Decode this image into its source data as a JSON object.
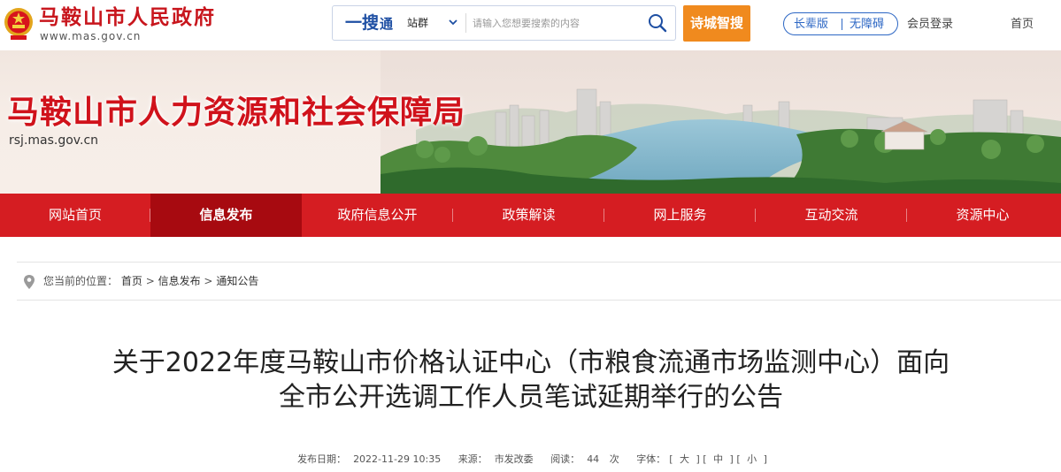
{
  "header": {
    "site_name": "马鞍山市人民政府",
    "site_url": "www.mas.gov.cn",
    "search": {
      "brand_a": "一搜",
      "brand_b": "通",
      "scope": "站群",
      "placeholder": "请输入您想要搜索的内容"
    },
    "poetry_search": "诗城智搜",
    "elder_mode": "长辈版",
    "accessibility": "无障碍",
    "member_login": "会员登录",
    "home": "首页"
  },
  "banner": {
    "bureau_name": "马鞍山市人力资源和社会保障局",
    "bureau_url": "rsj.mas.gov.cn"
  },
  "nav": {
    "items": [
      {
        "label": "网站首页"
      },
      {
        "label": "信息发布"
      },
      {
        "label": "政府信息公开"
      },
      {
        "label": "政策解读"
      },
      {
        "label": "网上服务"
      },
      {
        "label": "互动交流"
      },
      {
        "label": "资源中心"
      }
    ],
    "active": "信息发布"
  },
  "breadcrumb": {
    "prefix": "您当前的位置：",
    "items": [
      "首页",
      "信息发布",
      "通知公告"
    ],
    "separator": ">"
  },
  "article": {
    "title_line1": "关于2022年度马鞍山市价格认证中心（市粮食流通市场监测中心）面向",
    "title_line2": "全市公开选调工作人员笔试延期举行的公告",
    "date_label": "发布日期：",
    "date": "2022-11-29 10:35",
    "source_label": "来源：",
    "source": "市发改委",
    "views_label": "阅读：",
    "views": "44",
    "views_unit": "次",
    "font_label": "字体：",
    "font_large": "大",
    "font_medium": "中",
    "font_small": "小"
  },
  "colors": {
    "brand_red": "#d51d22",
    "nav_active": "#a70a10",
    "title_red": "#c8161d",
    "search_blue": "#1e4fa3",
    "accent_orange": "#f08a1e"
  },
  "icons": {
    "emblem": "national-emblem-icon",
    "search": "search-icon",
    "chevron": "chevron-down-icon",
    "location": "location-pin-icon"
  }
}
